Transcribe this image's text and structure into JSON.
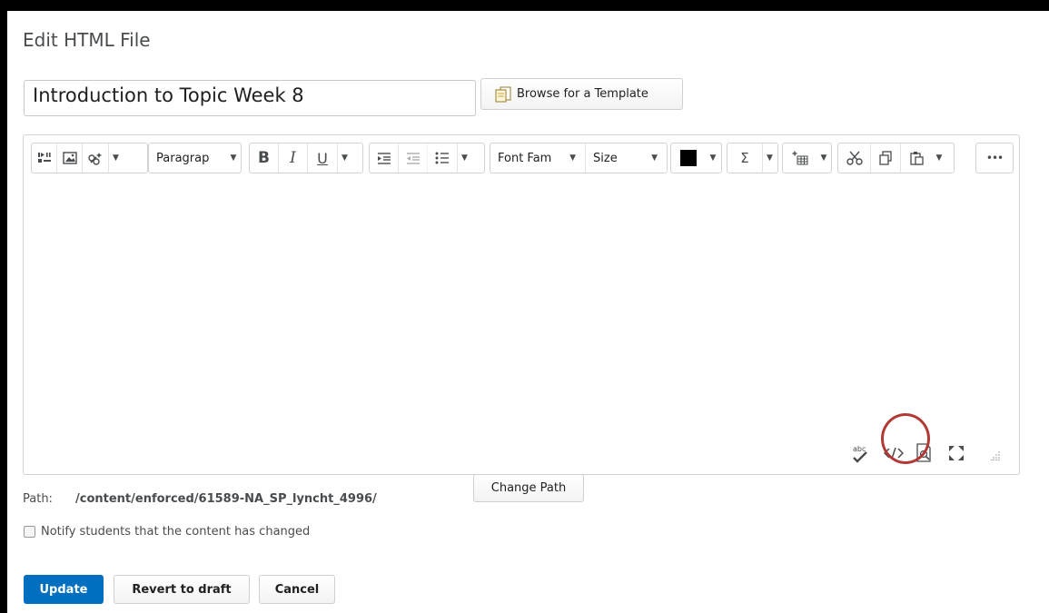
{
  "page": {
    "title": "Edit HTML File"
  },
  "title_field": {
    "value": "Introduction to Topic Week 8"
  },
  "template_button": {
    "label": "Browse for a Template"
  },
  "toolbar": {
    "format_dropdown": "Paragrap",
    "font_family_dropdown": "Font Fam",
    "size_dropdown": "Size",
    "bold": "B",
    "italic": "I",
    "underline": "U",
    "sigma": "Σ",
    "more": "•••",
    "text_color": "#000000"
  },
  "status_bar": {
    "spellcheck_label": "abc"
  },
  "path": {
    "label": "Path:",
    "value": "/content/enforced/61589-NA_SP_lyncht_4996/",
    "change_button": "Change Path"
  },
  "notify": {
    "label": "Notify students that the content has changed",
    "checked": false
  },
  "actions": {
    "update": "Update",
    "revert": "Revert to draft",
    "cancel": "Cancel"
  },
  "colors": {
    "primary": "#006fbf",
    "annotation_circle": "#b23a36"
  }
}
